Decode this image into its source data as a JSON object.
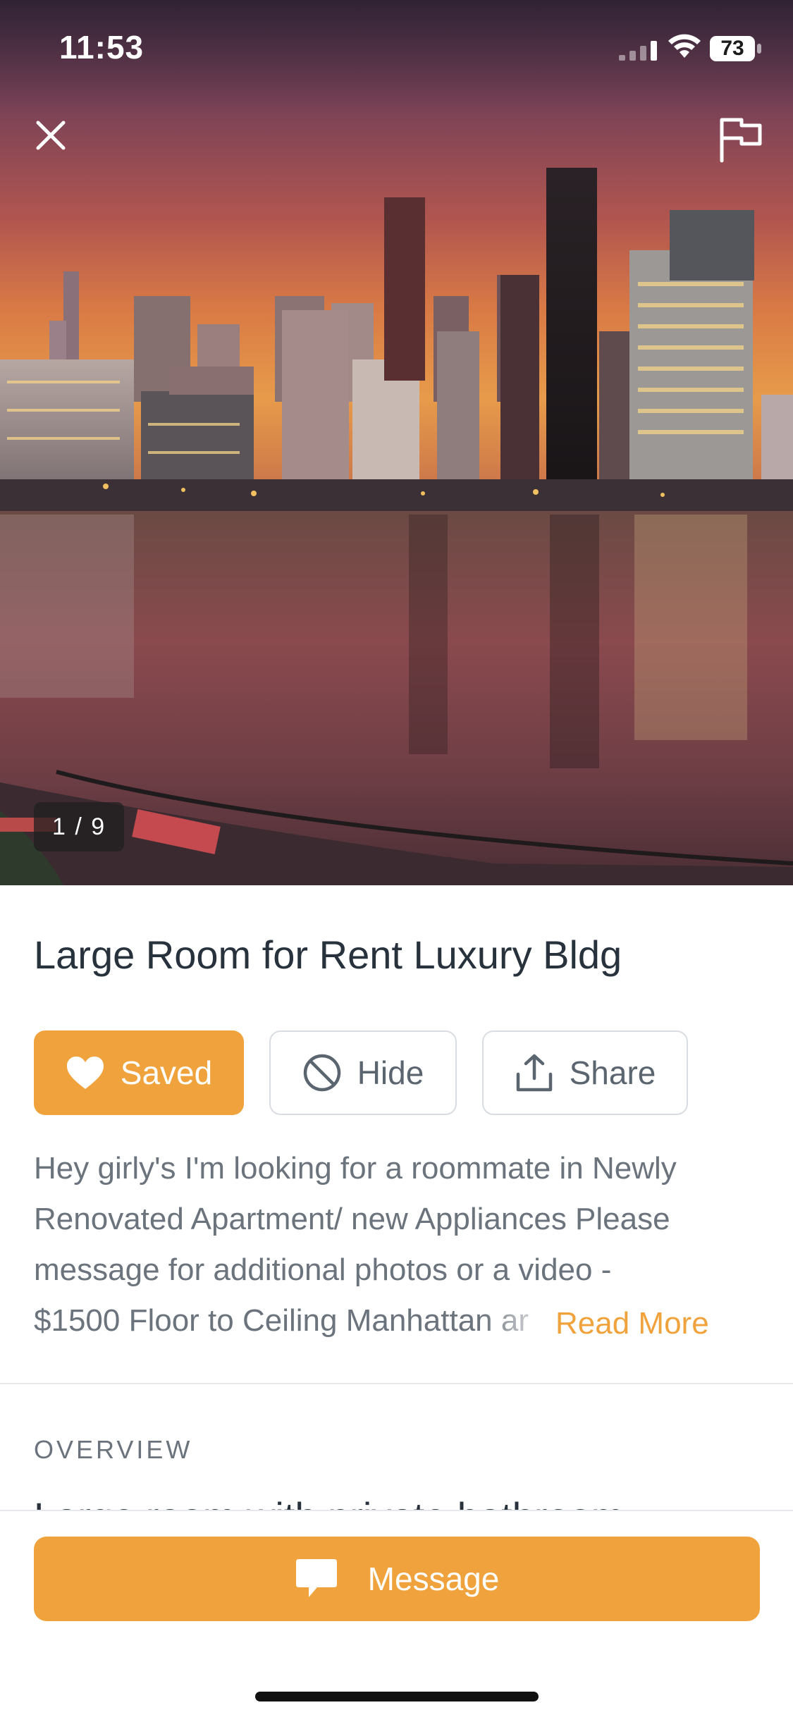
{
  "status_bar": {
    "time": "11:53",
    "battery": "73"
  },
  "gallery": {
    "counter": "1 / 9"
  },
  "listing": {
    "title": "Large Room for Rent Luxury Bldg",
    "actions": {
      "saved_label": "Saved",
      "hide_label": "Hide",
      "share_label": "Share"
    },
    "description": {
      "lines": [
        "Hey girly's I'm looking for a roommate in Newly",
        "Renovated Apartment/ new Appliances Please",
        "message for additional photos or a video -",
        "$1500 Floor to Ceiling Manhattan ar"
      ],
      "read_more": "Read More"
    },
    "overview": {
      "label": "OVERVIEW",
      "text": "Large room with private bathroom"
    }
  },
  "footer": {
    "message_label": "Message"
  },
  "colors": {
    "accent": "#f0a33c",
    "title": "#28323d",
    "muted": "#6b737c",
    "border": "#d9dde2"
  },
  "icons": [
    "close-icon",
    "flag-icon",
    "heart-icon",
    "block-icon",
    "share-icon",
    "chat-bubble-icon",
    "wifi-icon",
    "cellular-signal-icon",
    "battery-icon"
  ]
}
